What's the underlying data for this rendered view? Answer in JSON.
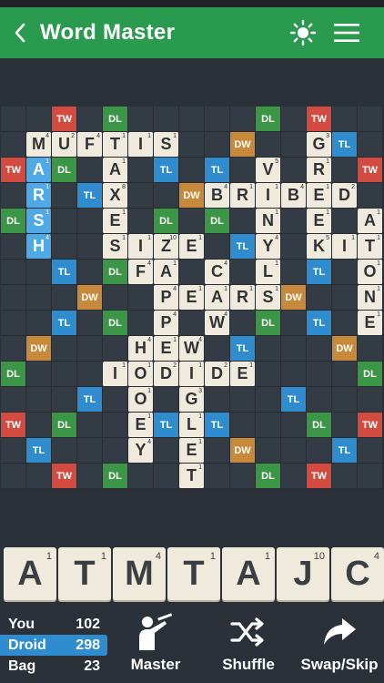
{
  "header": {
    "title": "Word Master"
  },
  "rack": [
    {
      "letter": "A",
      "value": "1"
    },
    {
      "letter": "T",
      "value": "1"
    },
    {
      "letter": "M",
      "value": "4"
    },
    {
      "letter": "T",
      "value": "1"
    },
    {
      "letter": "A",
      "value": "1"
    },
    {
      "letter": "J",
      "value": "10"
    },
    {
      "letter": "C",
      "value": "4"
    }
  ],
  "scores": [
    {
      "name": "You",
      "score": "102"
    },
    {
      "name": "Droid",
      "score": "298"
    },
    {
      "name": "Bag",
      "score": "23"
    }
  ],
  "actions": {
    "master": "Master",
    "shuffle": "Shuffle",
    "swap": "Swap/Skip"
  },
  "board": {
    "bonus": [
      [
        0,
        2,
        "TW"
      ],
      [
        0,
        4,
        "DL"
      ],
      [
        0,
        10,
        "DL"
      ],
      [
        0,
        12,
        "TW"
      ],
      [
        1,
        9,
        "DW"
      ],
      [
        1,
        13,
        "TL"
      ],
      [
        2,
        0,
        "TW"
      ],
      [
        2,
        2,
        "DL"
      ],
      [
        2,
        6,
        "TL"
      ],
      [
        2,
        8,
        "TL"
      ],
      [
        2,
        14,
        "TW"
      ],
      [
        3,
        3,
        "TL"
      ],
      [
        3,
        7,
        "DW"
      ],
      [
        4,
        0,
        "DL"
      ],
      [
        4,
        6,
        "DL"
      ],
      [
        4,
        8,
        "DL"
      ],
      [
        5,
        9,
        "TL"
      ],
      [
        6,
        2,
        "TL"
      ],
      [
        6,
        4,
        "DL"
      ],
      [
        6,
        12,
        "TL"
      ],
      [
        7,
        3,
        "DW"
      ],
      [
        7,
        11,
        "DW"
      ],
      [
        8,
        2,
        "TL"
      ],
      [
        8,
        4,
        "DL"
      ],
      [
        8,
        10,
        "DL"
      ],
      [
        8,
        12,
        "TL"
      ],
      [
        9,
        1,
        "DW"
      ],
      [
        9,
        9,
        "TL"
      ],
      [
        9,
        13,
        "DW"
      ],
      [
        10,
        0,
        "DL"
      ],
      [
        10,
        14,
        "DL"
      ],
      [
        11,
        3,
        "TL"
      ],
      [
        11,
        11,
        "TL"
      ],
      [
        12,
        0,
        "TW"
      ],
      [
        12,
        2,
        "DL"
      ],
      [
        12,
        6,
        "TL"
      ],
      [
        12,
        8,
        "TL"
      ],
      [
        12,
        12,
        "DL"
      ],
      [
        12,
        14,
        "TW"
      ],
      [
        13,
        1,
        "TL"
      ],
      [
        13,
        9,
        "DW"
      ],
      [
        13,
        13,
        "TL"
      ],
      [
        14,
        2,
        "TW"
      ],
      [
        14,
        4,
        "DL"
      ],
      [
        14,
        10,
        "DL"
      ],
      [
        14,
        12,
        "TW"
      ]
    ],
    "tiles": [
      [
        1,
        1,
        "M",
        "4",
        0
      ],
      [
        1,
        2,
        "U",
        "2",
        0
      ],
      [
        1,
        3,
        "F",
        "4",
        0
      ],
      [
        1,
        4,
        "T",
        "1",
        0
      ],
      [
        1,
        5,
        "I",
        "1",
        0
      ],
      [
        1,
        6,
        "S",
        "1",
        0
      ],
      [
        1,
        12,
        "G",
        "3",
        0
      ],
      [
        2,
        1,
        "A",
        "1",
        1
      ],
      [
        2,
        4,
        "A",
        "1",
        0
      ],
      [
        2,
        10,
        "V",
        "5",
        0
      ],
      [
        2,
        12,
        "R",
        "1",
        0
      ],
      [
        3,
        1,
        "R",
        "1",
        1
      ],
      [
        3,
        4,
        "X",
        "8",
        0
      ],
      [
        3,
        8,
        "B",
        "4",
        0
      ],
      [
        3,
        9,
        "R",
        "1",
        0
      ],
      [
        3,
        10,
        "I",
        "1",
        0
      ],
      [
        3,
        11,
        "B",
        "4",
        0
      ],
      [
        3,
        12,
        "E",
        "1",
        0
      ],
      [
        3,
        13,
        "D",
        "2",
        0
      ],
      [
        4,
        1,
        "S",
        "1",
        1
      ],
      [
        4,
        4,
        "E",
        "1",
        0
      ],
      [
        4,
        10,
        "N",
        "1",
        0
      ],
      [
        4,
        12,
        "E",
        "1",
        0
      ],
      [
        4,
        14,
        "A",
        "1",
        0
      ],
      [
        5,
        1,
        "H",
        "4",
        1
      ],
      [
        5,
        4,
        "S",
        "1",
        0
      ],
      [
        5,
        5,
        "I",
        "1",
        0
      ],
      [
        5,
        6,
        "Z",
        "10",
        0
      ],
      [
        5,
        7,
        "E",
        "1",
        0
      ],
      [
        5,
        10,
        "Y",
        "4",
        0
      ],
      [
        5,
        12,
        "K",
        "5",
        0
      ],
      [
        5,
        13,
        "I",
        "1",
        0
      ],
      [
        5,
        14,
        "T",
        "1",
        0
      ],
      [
        6,
        5,
        "F",
        "4",
        0
      ],
      [
        6,
        6,
        "A",
        "1",
        0
      ],
      [
        6,
        8,
        "C",
        "4",
        0
      ],
      [
        6,
        10,
        "L",
        "1",
        0
      ],
      [
        6,
        14,
        "O",
        "1",
        0
      ],
      [
        7,
        6,
        "P",
        "4",
        0
      ],
      [
        7,
        7,
        "E",
        "1",
        0
      ],
      [
        7,
        8,
        "A",
        "1",
        0
      ],
      [
        7,
        9,
        "R",
        "1",
        0
      ],
      [
        7,
        10,
        "S",
        "1",
        0
      ],
      [
        7,
        14,
        "N",
        "1",
        0
      ],
      [
        8,
        6,
        "P",
        "4",
        0
      ],
      [
        8,
        8,
        "W",
        "4",
        0
      ],
      [
        8,
        14,
        "E",
        "1",
        0
      ],
      [
        9,
        5,
        "H",
        "4",
        0
      ],
      [
        9,
        6,
        "E",
        "1",
        0
      ],
      [
        9,
        7,
        "W",
        "4",
        0
      ],
      [
        10,
        4,
        "I",
        "1",
        0
      ],
      [
        10,
        5,
        "O",
        "1",
        0
      ],
      [
        10,
        6,
        "D",
        "2",
        0
      ],
      [
        10,
        7,
        "I",
        "1",
        0
      ],
      [
        10,
        8,
        "D",
        "2",
        0
      ],
      [
        10,
        9,
        "E",
        "1",
        0
      ],
      [
        11,
        5,
        "O",
        "1",
        0
      ],
      [
        11,
        7,
        "G",
        "3",
        0
      ],
      [
        12,
        5,
        "E",
        "1",
        0
      ],
      [
        12,
        7,
        "L",
        "1",
        0
      ],
      [
        13,
        5,
        "Y",
        "4",
        0
      ],
      [
        13,
        7,
        "E",
        "1",
        0
      ],
      [
        14,
        7,
        "T",
        "1",
        0
      ]
    ]
  }
}
